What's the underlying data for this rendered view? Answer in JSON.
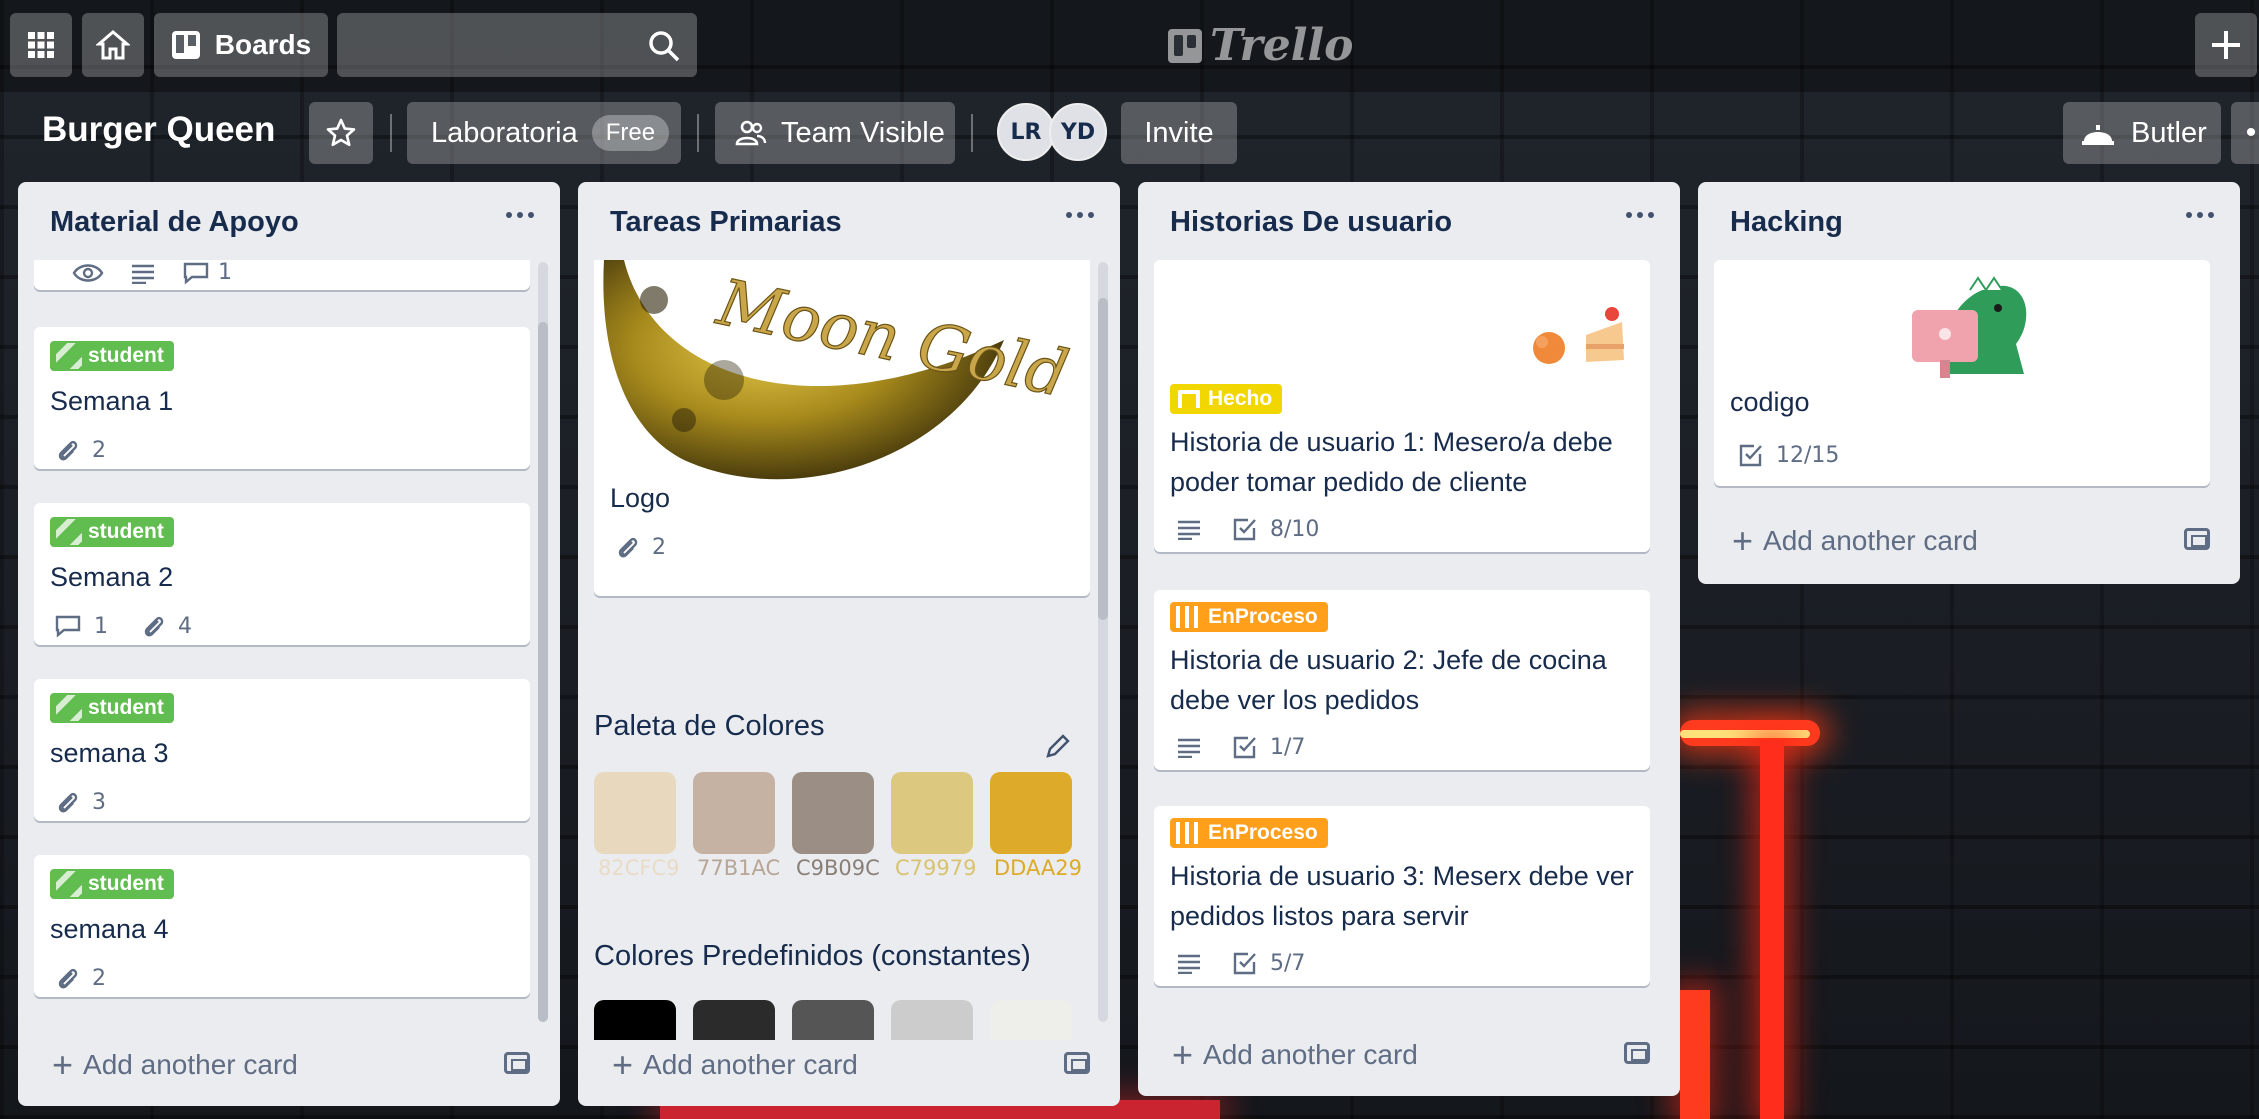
{
  "topbar": {
    "boards_label": "Boards",
    "logo_text": "Trello"
  },
  "board": {
    "title": "Burger Queen",
    "workspace": "Laboratoria",
    "workspace_plan": "Free",
    "visibility": "Team Visible",
    "members": [
      "LR",
      "YD"
    ],
    "invite_label": "Invite",
    "butler_label": "Butler"
  },
  "lists": [
    {
      "title": "Material de Apoyo",
      "top_badge_count": "1",
      "cards": [
        {
          "label": "student",
          "title": "Semana 1",
          "attachments": "2"
        },
        {
          "label": "student",
          "title": "Semana 2",
          "comments": "1",
          "attachments": "4"
        },
        {
          "label": "student",
          "title": "semana 3",
          "attachments": "3"
        },
        {
          "label": "student",
          "title": "semana 4",
          "attachments": "2"
        }
      ],
      "add_label": "Add another card"
    },
    {
      "title": "Tareas Primarias",
      "cards": [
        {
          "cover_text": "Moon Gold",
          "title": "Logo",
          "attachments": "2"
        }
      ],
      "palette_title": "Paleta de Colores",
      "palette": [
        {
          "hex": "#E8D9BE",
          "label": "82CFC9",
          "label_color": "#e8dcc6"
        },
        {
          "hex": "#C6B2A3",
          "label": "77B1AC",
          "label_color": "#b7a596"
        },
        {
          "hex": "#9B8E84",
          "label": "C9B09C",
          "label_color": "#8a7f76"
        },
        {
          "hex": "#DCC97F",
          "label": "C79979",
          "label_color": "#d8c36f"
        },
        {
          "hex": "#DDAA29",
          "label": "DDAA29",
          "label_color": "#ddaa29"
        }
      ],
      "predef_title": "Colores Predefinidos (constantes)",
      "predef": [
        "#000000",
        "#2b2b2b",
        "#555555",
        "#cccccc",
        "#eeeeea"
      ],
      "add_label": "Add another card"
    },
    {
      "title": "Historias De usuario",
      "cards": [
        {
          "label": "Hecho",
          "title": "Historia de usuario 1: Mesero/a debe poder tomar pedido de cliente",
          "checklist": "8/10"
        },
        {
          "label": "EnProceso",
          "title": "Historia de usuario 2: Jefe de cocina debe ver los pedidos",
          "checklist": "1/7"
        },
        {
          "label": "EnProceso",
          "title": "Historia de usuario 3: Meserx debe ver pedidos listos para servir",
          "checklist": "5/7"
        }
      ],
      "add_label": "Add another card"
    },
    {
      "title": "Hacking",
      "cards": [
        {
          "title": "codigo",
          "checklist": "12/15"
        }
      ],
      "add_label": "Add another card"
    }
  ]
}
